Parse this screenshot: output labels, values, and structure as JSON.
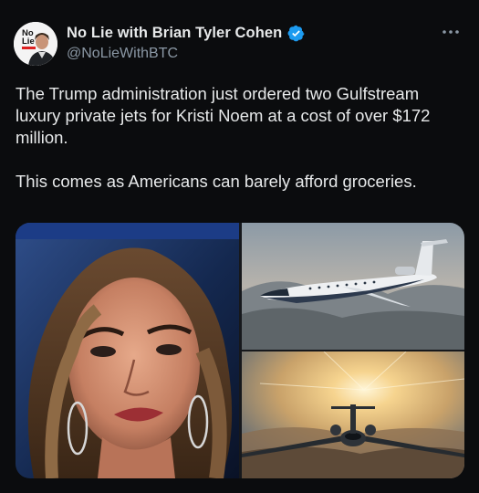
{
  "author": {
    "display_name": "No Lie with Brian Tyler Cohen",
    "handle": "@NoLieWithBTC",
    "avatar_text_line1": "No",
    "avatar_text_line2": "Lie"
  },
  "tweet": {
    "paragraph_1": "The Trump administration just ordered two Gulfstream luxury private jets for Kristi Noem at a cost of over $172 million.",
    "paragraph_2": "This comes as Americans can barely afford groceries."
  },
  "media": [
    {
      "icon": "portrait-photo",
      "description": "woman portrait"
    },
    {
      "icon": "jet-photo",
      "description": "private jet flying above mountains"
    },
    {
      "icon": "jet-photo",
      "description": "private jet flying toward sunset"
    }
  ],
  "colors": {
    "background": "#0b0c0e",
    "text": "#e7e9ea",
    "secondary_text": "#8b98a5",
    "verified_blue": "#1d9bf0"
  },
  "icons": {
    "verified": "verified-badge-icon",
    "more": "more-options-icon"
  }
}
